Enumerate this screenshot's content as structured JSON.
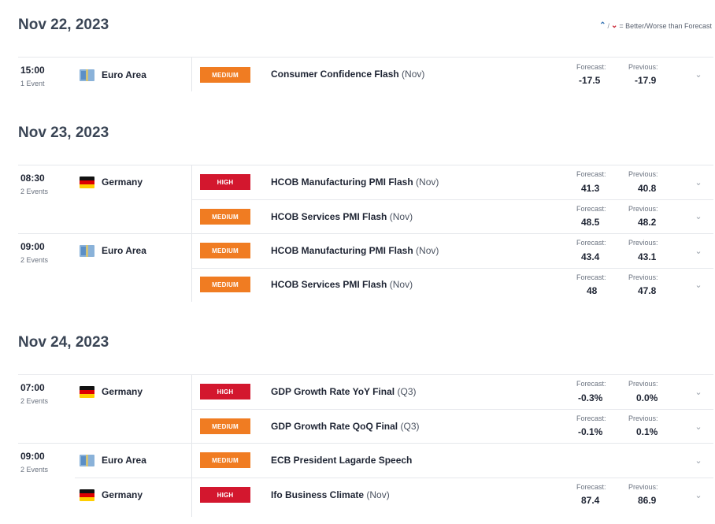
{
  "legend": {
    "better_icon": "arrow-up-icon",
    "worse_icon": "arrow-down-icon",
    "text": "= Better/Worse than Forecast"
  },
  "labels": {
    "forecast": "Forecast:",
    "previous": "Previous:"
  },
  "days": [
    {
      "date": "Nov 22, 2023",
      "groups": [
        {
          "time": "15:00",
          "events": "1 Event",
          "country": "Euro Area",
          "flag": "eu-flag-icon"
        }
      ],
      "rows": [
        {
          "impact": "MEDIUM",
          "title": "Consumer Confidence Flash",
          "period": "(Nov)",
          "forecast": "-17.5",
          "previous": "-17.9"
        }
      ]
    },
    {
      "date": "Nov 23, 2023",
      "groups": [
        {
          "time": "08:30",
          "events": "2 Events",
          "country": "Germany",
          "flag": "germany-flag-icon"
        },
        {
          "time": "09:00",
          "events": "2 Events",
          "country": "Euro Area",
          "flag": "eu-flag-icon"
        }
      ],
      "rows": [
        {
          "impact": "HIGH",
          "title": "HCOB Manufacturing PMI Flash",
          "period": "(Nov)",
          "forecast": "41.3",
          "previous": "40.8"
        },
        {
          "impact": "MEDIUM",
          "title": "HCOB Services PMI Flash",
          "period": "(Nov)",
          "forecast": "48.5",
          "previous": "48.2"
        },
        {
          "impact": "MEDIUM",
          "title": "HCOB Manufacturing PMI Flash",
          "period": "(Nov)",
          "forecast": "43.4",
          "previous": "43.1"
        },
        {
          "impact": "MEDIUM",
          "title": "HCOB Services PMI Flash",
          "period": "(Nov)",
          "forecast": "48",
          "previous": "47.8"
        }
      ]
    },
    {
      "date": "Nov 24, 2023",
      "groups": [
        {
          "time": "07:00",
          "events": "2 Events",
          "country": "Germany",
          "flag": "germany-flag-icon"
        },
        {
          "time": "09:00",
          "events": "2 Events",
          "country": "Euro Area",
          "flag": "eu-flag-icon"
        },
        {
          "time": "",
          "events": "",
          "country": "Germany",
          "flag": "germany-flag-icon"
        }
      ],
      "rows": [
        {
          "impact": "HIGH",
          "title": "GDP Growth Rate YoY Final",
          "period": "(Q3)",
          "forecast": "-0.3%",
          "previous": "0.0%"
        },
        {
          "impact": "MEDIUM",
          "title": "GDP Growth Rate QoQ Final",
          "period": "(Q3)",
          "forecast": "-0.1%",
          "previous": "0.1%"
        },
        {
          "impact": "MEDIUM",
          "title": "ECB President Lagarde Speech",
          "period": "",
          "forecast": "",
          "previous": ""
        },
        {
          "impact": "HIGH",
          "title": "Ifo Business Climate",
          "period": "(Nov)",
          "forecast": "87.4",
          "previous": "86.9"
        }
      ]
    }
  ],
  "chevron_icon": "chevron-down-icon"
}
